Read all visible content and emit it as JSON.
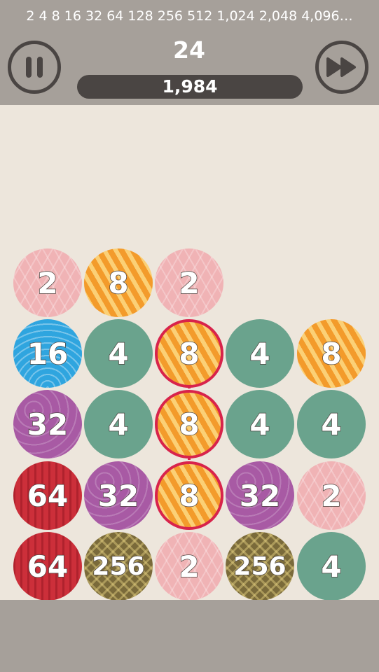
{
  "header": {
    "sequence": "2 4 8 16 32 64 128 256 512 1,024 2,048 4,096…",
    "level": "24",
    "score": "1,984"
  },
  "board": {
    "rows": [
      [
        "2",
        "8",
        "2",
        "",
        ""
      ],
      [
        "16",
        "4",
        "8",
        "4",
        "8"
      ],
      [
        "32",
        "4",
        "8",
        "4",
        "4"
      ],
      [
        "64",
        "32",
        "8",
        "32",
        "2"
      ],
      [
        "64",
        "256",
        "2",
        "256",
        "4"
      ]
    ]
  },
  "colors": {
    "2": "#f0b3b5",
    "4": "#6aa38d",
    "8": "#f39b2b",
    "16": "#2fa5df",
    "32": "#a85aa4",
    "64": "#cc2f3a",
    "256": "#7a6a3a",
    "selected_ring": "#d8234b"
  },
  "icons": {
    "pause": "pause-icon",
    "skip": "fast-forward-icon"
  }
}
